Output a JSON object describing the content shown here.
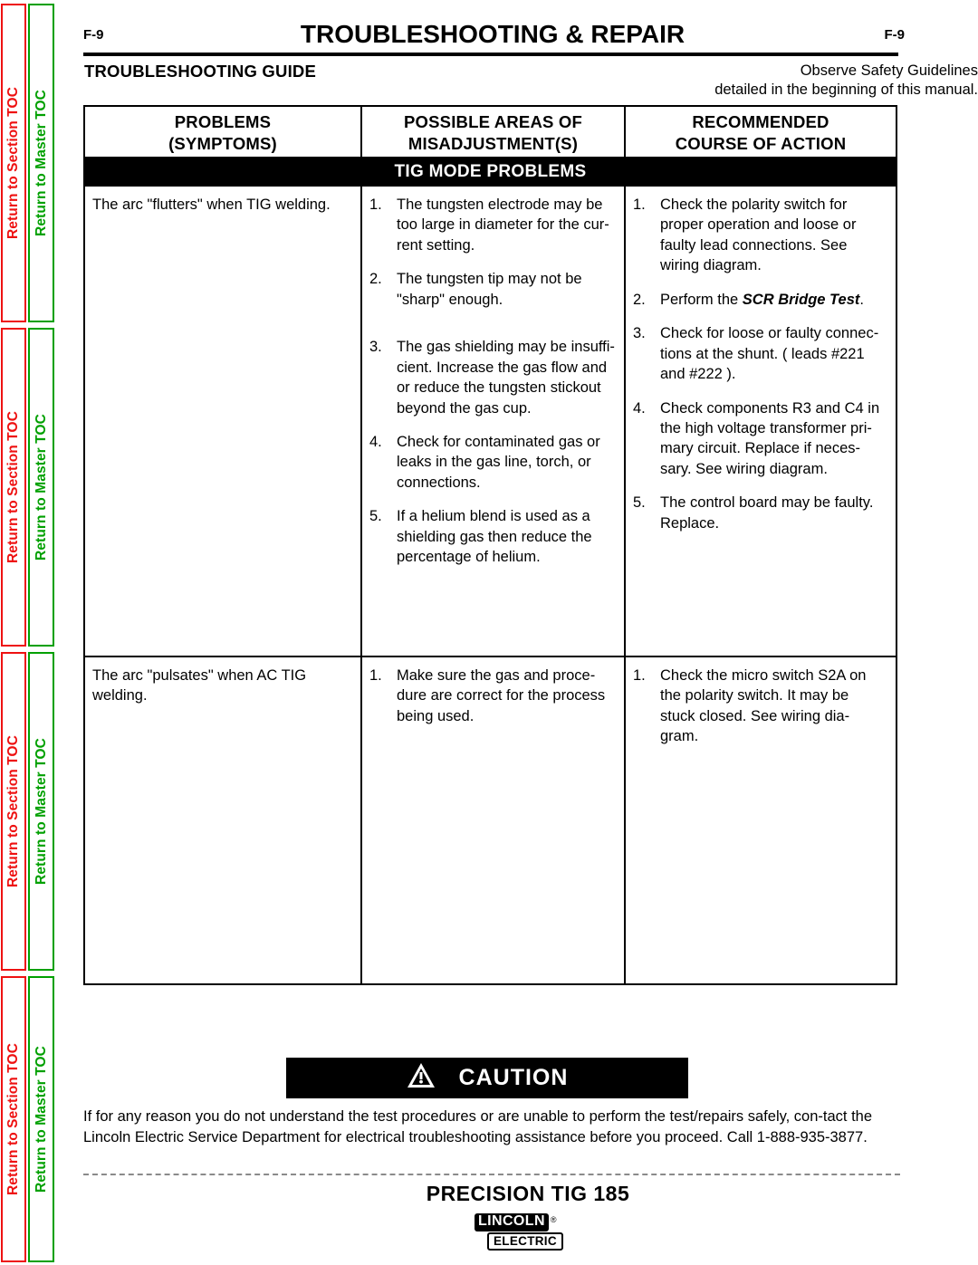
{
  "sidebar": {
    "tabs": [
      {
        "label": "Return to Section TOC",
        "color": "#ee1111",
        "kind": "section"
      },
      {
        "label": "Return to Master TOC",
        "color": "#00a000",
        "kind": "master"
      },
      {
        "label": "Return to Section TOC",
        "color": "#ee1111",
        "kind": "section"
      },
      {
        "label": "Return to Master TOC",
        "color": "#00a000",
        "kind": "master"
      },
      {
        "label": "Return to Section TOC",
        "color": "#ee1111",
        "kind": "section"
      },
      {
        "label": "Return to Master TOC",
        "color": "#00a000",
        "kind": "master"
      },
      {
        "label": "Return to Section TOC",
        "color": "#ee1111",
        "kind": "section"
      },
      {
        "label": "Return to Master TOC",
        "color": "#00a000",
        "kind": "master"
      }
    ]
  },
  "header": {
    "folio_left": "F-9",
    "folio_right": "F-9",
    "running_title": "TROUBLESHOOTING & REPAIR",
    "guide_title": "TROUBLESHOOTING GUIDE",
    "safety_note_line1": "Observe Safety Guidelines",
    "safety_note_line2": "detailed in the beginning of this manual."
  },
  "table": {
    "columns": [
      {
        "line1": "PROBLEMS",
        "line2": "(SYMPTOMS)"
      },
      {
        "line1": "POSSIBLE AREAS OF",
        "line2": "MISADJUSTMENT(S)"
      },
      {
        "line1": "RECOMMENDED",
        "line2": "COURSE OF ACTION"
      }
    ],
    "section_band": "TIG MODE PROBLEMS",
    "rows": [
      {
        "symptom": "The arc \"flutters\" when TIG welding.",
        "misadjustments": [
          {
            "num": "1.",
            "text": "The tungsten electrode may be too large in diameter for the cur-rent setting."
          },
          {
            "num": "2.",
            "text": "The tungsten tip may not be \"sharp\" enough."
          },
          {
            "num": "3.",
            "text": "The gas shielding may be insuffi-cient.  Increase the gas flow and or reduce the tungsten stickout beyond the gas cup."
          },
          {
            "num": "4.",
            "text": "Check for contaminated gas or leaks in the gas line, torch, or connections."
          },
          {
            "num": "5.",
            "text": "If a helium blend is used as a shielding gas then reduce the percentage of helium."
          }
        ],
        "actions": [
          {
            "num": "1.",
            "pre": "Check the polarity switch for proper operation and loose or faulty lead connections.  See wiring diagram.",
            "em": "",
            "post": ""
          },
          {
            "num": "2.",
            "pre": "Perform the ",
            "em": "SCR Bridge Test",
            "post": "."
          },
          {
            "num": "3.",
            "pre": "Check for loose or faulty connec-tions at the shunt. ( leads #221 and #222 ).",
            "em": "",
            "post": ""
          },
          {
            "num": "4.",
            "pre": "Check components R3 and C4 in the high voltage transformer pri-mary circuit.  Replace if neces-sary. See wiring diagram.",
            "em": "",
            "post": ""
          },
          {
            "num": "5.",
            "pre": "The control board may be faulty.  Replace.",
            "em": "",
            "post": ""
          }
        ]
      },
      {
        "symptom": "The arc \"pulsates\" when AC TIG welding.",
        "misadjustments": [
          {
            "num": "1.",
            "text": "Make sure the gas and proce-dure are correct for the process being used."
          }
        ],
        "actions": [
          {
            "num": "1.",
            "pre": "Check the micro switch S2A on the polarity switch.  It may be stuck closed.   See wiring dia-gram.",
            "em": "",
            "post": ""
          }
        ]
      }
    ]
  },
  "caution": {
    "icon": "warning-triangle-icon",
    "label": "CAUTION",
    "body": "If for any reason you do not understand the test procedures or are unable to perform the test/repairs safely, con-tact the Lincoln Electric Service Department for electrical troubleshooting assistance before you proceed.  Call 1-888-935-3877."
  },
  "footer": {
    "model": "PRECISION TIG 185",
    "logo_primary": "LINCOLN",
    "logo_registered": "®",
    "logo_secondary": "ELECTRIC"
  }
}
